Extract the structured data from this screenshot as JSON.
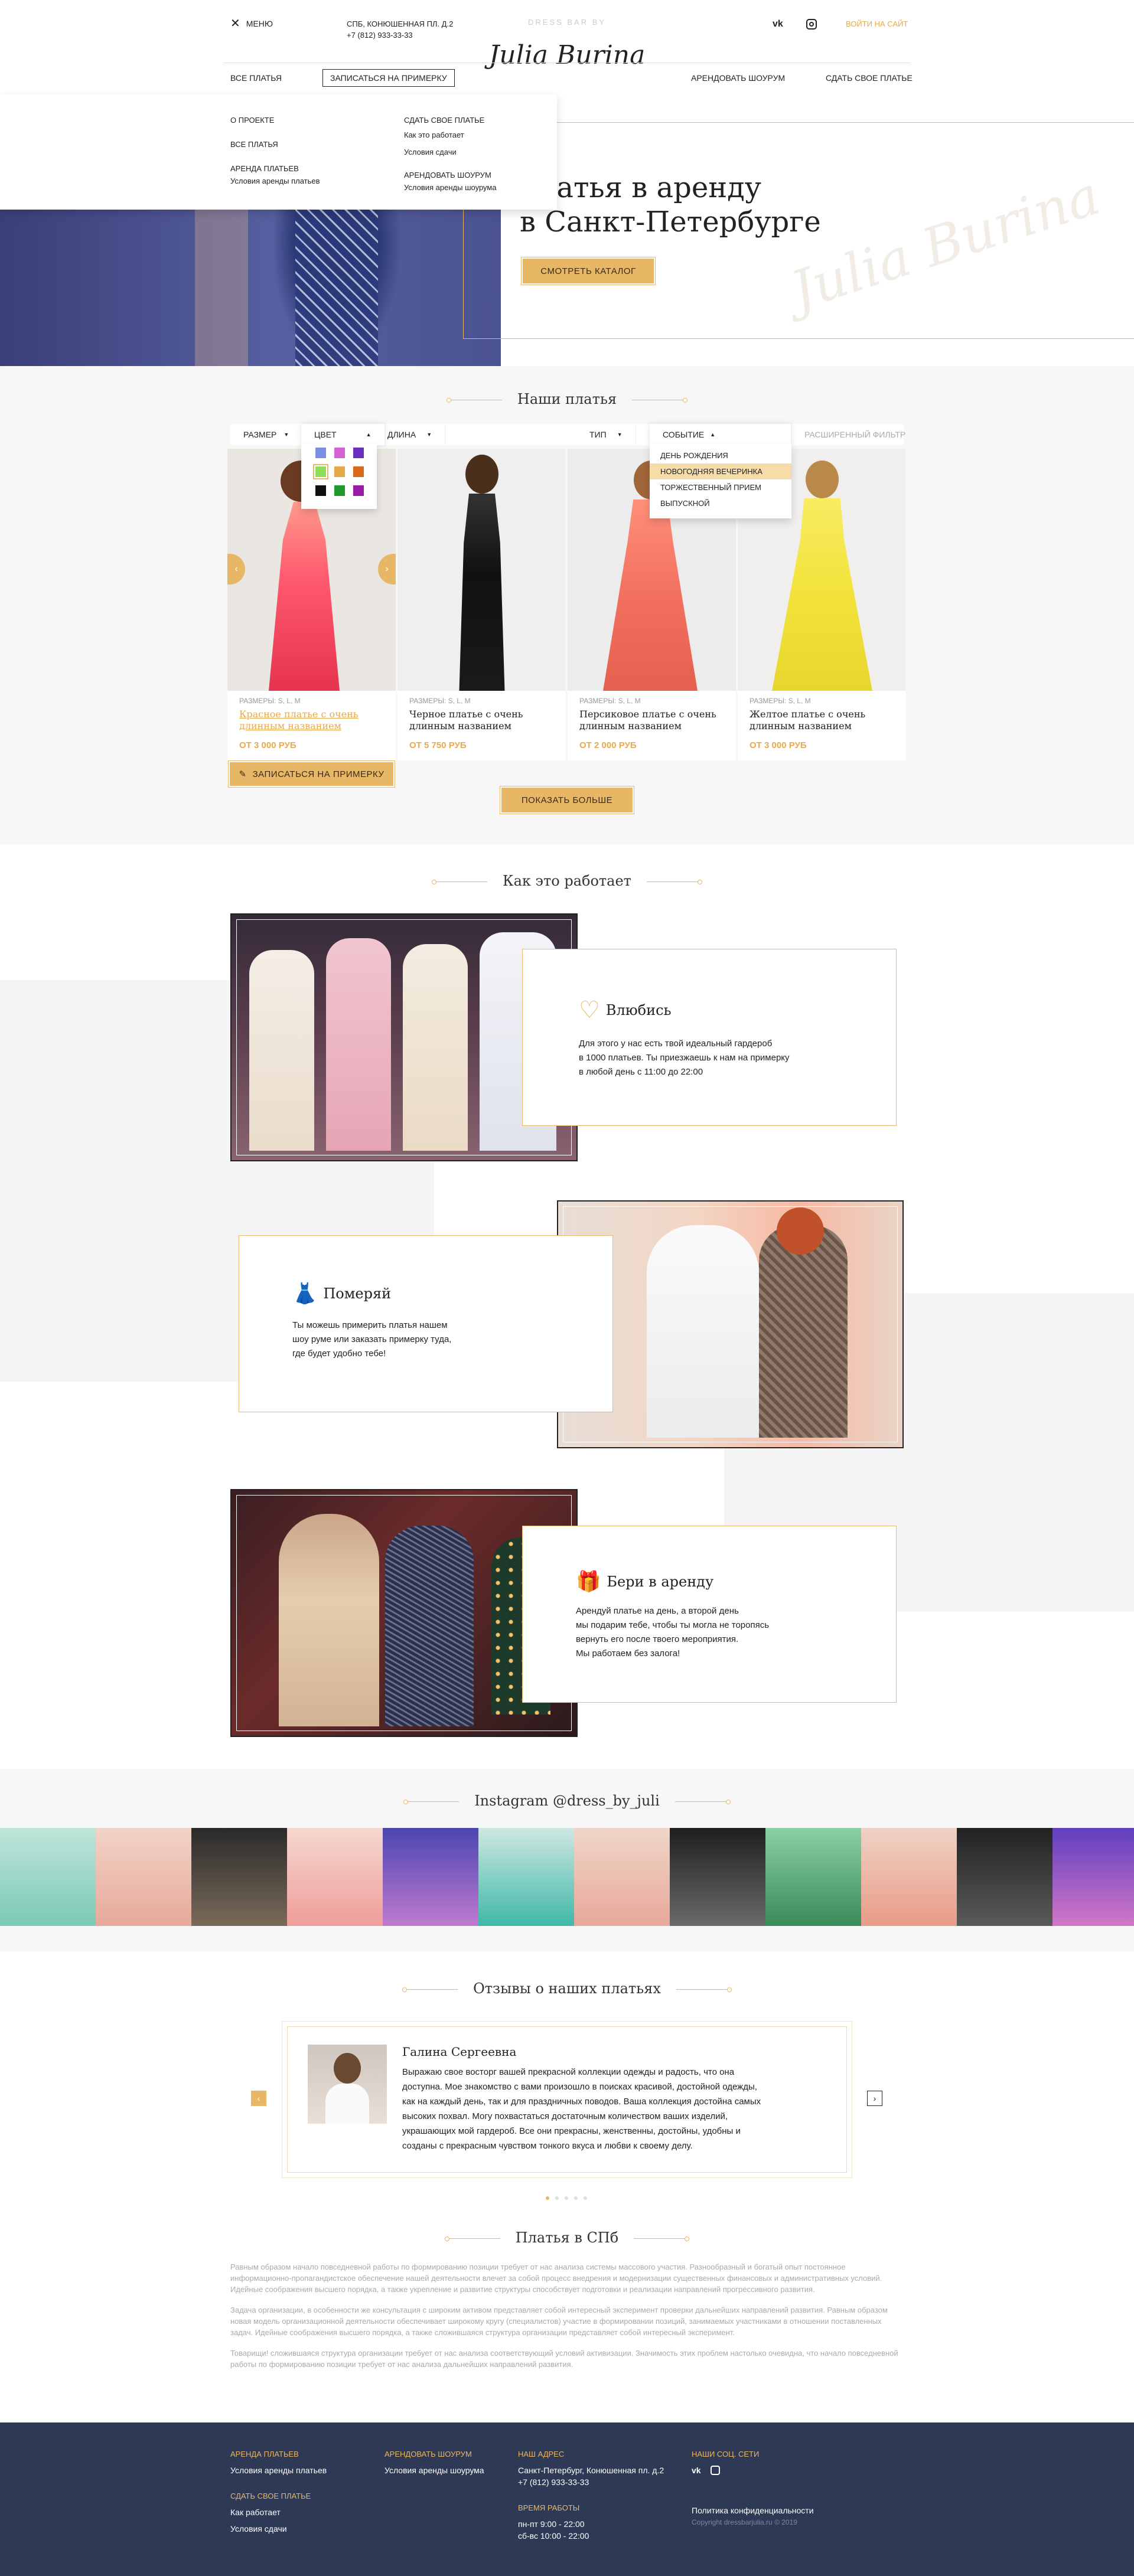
{
  "header": {
    "menu_label": "МЕНЮ",
    "address": "СПБ, КОНЮШЕННАЯ ПЛ. Д.2",
    "phone": "+7 (812) 933-33-33",
    "brand_top": "DRESS BAR BY",
    "brand_name": "Julia Burina",
    "login": "ВОЙТИ НА САЙТ",
    "nav": [
      "ВСЕ ПЛАТЬЯ",
      "ЗАПИСАТЬСЯ НА ПРИМЕРКУ",
      "АРЕНДОВАТЬ ШОУРУМ",
      "СДАТЬ СВОЕ ПЛАТЬЕ"
    ]
  },
  "menu_dropdown": {
    "col1": [
      "О ПРОЕКТЕ",
      "ВСЕ ПЛАТЬЯ",
      "АРЕНДА ПЛАТЬЕВ"
    ],
    "col1_sub": "Условия аренды платьев",
    "col2_title": "СДАТЬ СВОЕ ПЛАТЬЕ",
    "col2_links": [
      "Как это работает",
      "Условия сдачи"
    ],
    "col2_title2": "АРЕНДОВАТЬ ШОУРУМ",
    "col2_sub": "Условия аренды шоурума"
  },
  "hero": {
    "line1": "Платья в аренду",
    "line2": "в Санкт-Петербурге",
    "button": "СМОТРЕТЬ КАТАЛОГ",
    "watermark": "Julia Burina"
  },
  "dresses": {
    "title": "Наши платья",
    "filters": [
      "РАЗМЕР",
      "ЦВЕТ",
      "ДЛИНА",
      "ТИП",
      "СОБЫТИЕ",
      "РАСШИРЕННЫЙ ФИЛЬТР"
    ],
    "colors": [
      "#7a8fe0",
      "#d660d6",
      "#6b2fc0",
      "#8edc5a",
      "#e6a84a",
      "#d86a1a",
      "#111111",
      "#1f9a2a",
      "#9a1aa8"
    ],
    "events": [
      "ДЕНЬ РОЖДЕНИЯ",
      "НОВОГОДНЯЯ ВЕЧЕРИНКА",
      "ТОРЖЕСТВЕННЫЙ ПРИЕМ",
      "ВЫПУСКНОЙ"
    ],
    "cards": [
      {
        "sizes": "РАЗМЕРЫ: S, L, M",
        "name": "Красное платье с очень длинным названием",
        "price": "ОТ 3 000 РУБ"
      },
      {
        "sizes": "РАЗМЕРЫ: S, L, M",
        "name": "Черное платье с очень длинным названием",
        "price": "ОТ 5 750 РУБ"
      },
      {
        "sizes": "РАЗМЕРЫ: S, L, M",
        "name": "Персиковое платье с очень длинным названием",
        "price": "ОТ 2 000 РУБ"
      },
      {
        "sizes": "РАЗМЕРЫ: S, L, M",
        "name": "Желтое платье с очень длинным названием",
        "price": "ОТ 3 000 РУБ"
      }
    ],
    "fitting_button": "ЗАПИСАТЬСЯ НА ПРИМЕРКУ",
    "more_button": "ПОКАЗАТЬ БОЛЬШЕ"
  },
  "how": {
    "title": "Как это работает",
    "steps": [
      {
        "title": "Влюбись",
        "text": [
          "Для этого у нас есть твой идеальный гардероб",
          "в 1000 платьев. Ты приезжаешь к нам на примерку",
          "в любой день с 11:00 до 22:00"
        ]
      },
      {
        "title": "Померяй",
        "text": [
          "Ты можешь примерить платья нашем",
          "шоу руме или заказать примерку туда,",
          "где будет удобно тебе!"
        ]
      },
      {
        "title": "Бери в аренду",
        "text": [
          "Арендуй платье на день, а второй день",
          "мы подарим тебе, чтобы ты могла не торопясь",
          "вернуть его после твоего мероприятия.",
          "Мы работаем без залога!"
        ]
      }
    ]
  },
  "instagram": {
    "title": "Instagram @dress_by_juli"
  },
  "reviews": {
    "title": "Отзывы о наших платьях",
    "name": "Галина Сергеевна",
    "text": [
      "Выражаю свое восторг вашей прекрасной коллекции одежды и радость, что она",
      "доступна. Мое знакомство с вами произошло в поисках красивой, достойной одежды,",
      "как на каждый день, так и для праздничных поводов. Ваша коллекция достойна самых",
      "высоких похвал. Могу похвастаться достаточным количеством ваших изделий,",
      "украшающих мой гардероб. Все они прекрасны, женственны, достойны, удобны и",
      "созданы с прекрасным чувством тонкого вкуса и любви к своему делу."
    ]
  },
  "seo": {
    "title": "Платья в СПб",
    "paragraphs": [
      "Равным образом начало повседневной работы по формированию позиции требует от нас анализа системы массового участия. Разнообразный и богатый опыт постоянное информационно-пропагандистское обеспечение нашей деятельности влечет за собой процесс внедрения и модернизации существенных финансовых и административных условий. Идейные соображения высшего порядка, а также укрепление и развитие структуры способствует подготовки и реализации направлений прогрессивного развития.",
      "Задача организации, в особенности же консультация с широким активом представляет собой интересный эксперимент проверки дальнейших направлений развития. Равным образом новая модель организационной деятельности обеспечивает широкому кругу (специалистов) участие в формировании позиций, занимаемых участниками в отношении поставленных задач. Идейные соображения высшего порядка, а также сложившаяся структура организации представляет собой интересный эксперимент.",
      "Товарищи! сложившаяся структура организации требует от нас анализа соответствующий условий активизации. Значимость этих проблем настолько очевидна, что начало повседневной работы по формированию позиции требует от нас анализа дальнейших направлений развития."
    ]
  },
  "footer": {
    "c1_h1": "АРЕНДА ПЛАТЬЕВ",
    "c1_l1": "Условия аренды платьев",
    "c1_h2": "СДАТЬ СВОЕ ПЛАТЬЕ",
    "c1_l2": [
      "Как работает",
      "Условия сдачи"
    ],
    "c2_h": "АРЕНДОВАТЬ ШОУРУМ",
    "c2_l": "Условия аренды шоурума",
    "c3_h": "НАШ АДРЕС",
    "c3_l": [
      "Санкт-Петербург, Конюшенная пл. д.2",
      "+7 (812) 933-33-33"
    ],
    "c3_h2": "ВРЕМЯ РАБОТЫ",
    "c3_l2": [
      "пн-пт 9:00 - 22:00",
      "сб-вс 10:00 - 22:00"
    ],
    "c4_h": "НАШИ СОЦ. СЕТИ",
    "privacy": "Политика конфиденциальности",
    "copyright": "Copyright dressbarjulia.ru © 2019"
  }
}
